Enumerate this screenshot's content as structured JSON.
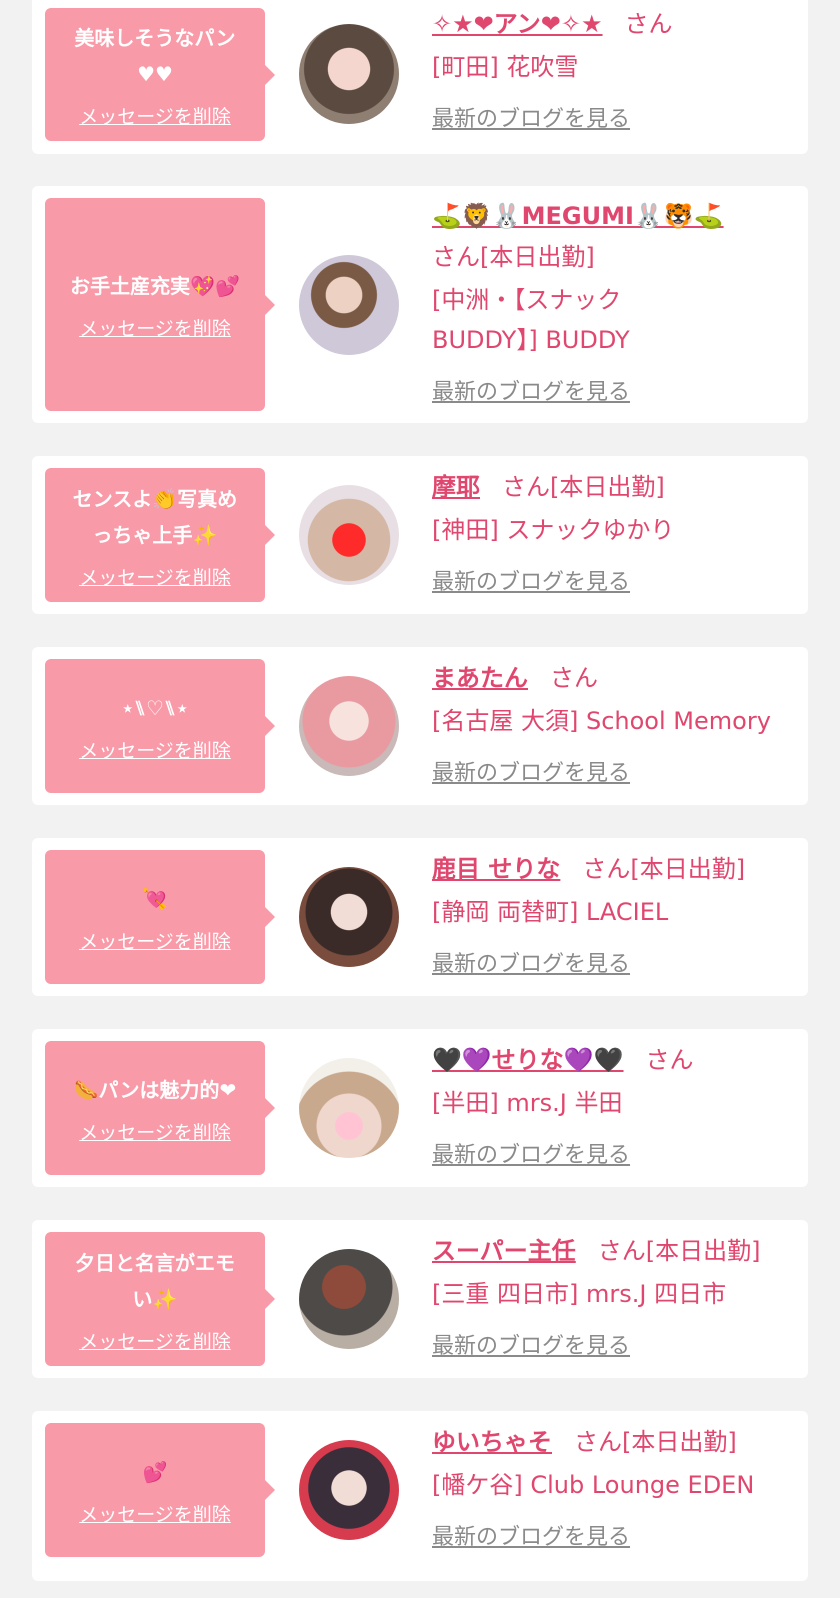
{
  "common": {
    "delete_label": "メッセージを削除",
    "blog_label": "最新のブログを見る"
  },
  "colors": {
    "background": "#f2f2f2",
    "bubble": "#f99aa8",
    "accent": "#e0476e",
    "link_gray": "#8a8a8a"
  },
  "messages": [
    {
      "comment": "美味しそうなパン\n♥♥",
      "cast_name": "✧★❤アン❤✧★",
      "honorific": "さん",
      "shop": "[町田] 花吹雪"
    },
    {
      "comment": "お手土産充実💖💕",
      "cast_name": "⛳🦁🐰MEGUMI🐰🐯⛳",
      "honorific": "さん[本日出勤]",
      "shop": "[中洲・【スナック\nBUDDY】] BUDDY"
    },
    {
      "comment": "センスよ👏写真め\nっちゃ上手✨",
      "cast_name": "摩耶",
      "honorific": "さん[本日出勤]",
      "shop": "[神田] スナックゆかり"
    },
    {
      "comment": "⋆⑊♡⑊⋆",
      "cast_name": "まあたん",
      "honorific": "さん",
      "shop": "[名古屋 大須] School Memory"
    },
    {
      "comment": "💘",
      "cast_name": "鹿目 せりな",
      "honorific": "さん[本日出勤]",
      "shop": "[静岡 両替町] LACIEL"
    },
    {
      "comment": "🌭パンは魅力的❤",
      "cast_name": "🖤💜せりな💜🖤",
      "honorific": "さん",
      "shop": "[半田] mrs.J 半田"
    },
    {
      "comment": "夕日と名言がエモ\nい✨",
      "cast_name": "スーパー主任",
      "honorific": "さん[本日出勤]",
      "shop": "[三重 四日市] mrs.J 四日市"
    },
    {
      "comment": "💕",
      "cast_name": "ゆいちゃそ",
      "honorific": "さん[本日出勤]",
      "shop": "[幡ケ谷] Club Lounge EDEN"
    }
  ]
}
